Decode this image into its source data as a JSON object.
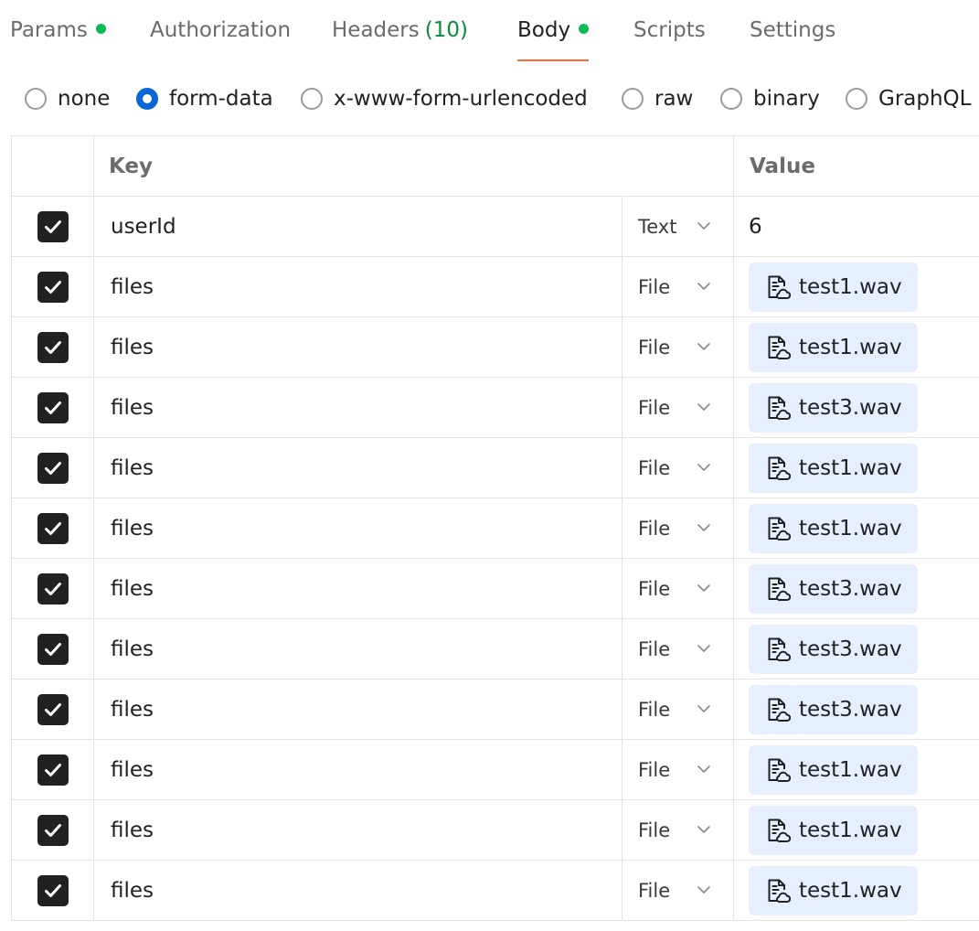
{
  "tabs": [
    {
      "label": "Params",
      "dot": true
    },
    {
      "label": "Authorization"
    },
    {
      "label": "Headers",
      "count": "(10)"
    },
    {
      "label": "Body",
      "dot": true,
      "active": true
    },
    {
      "label": "Scripts"
    },
    {
      "label": "Settings"
    }
  ],
  "body_types": [
    {
      "label": "none"
    },
    {
      "label": "form-data",
      "selected": true
    },
    {
      "label": "x-www-form-urlencoded"
    },
    {
      "label": "raw"
    },
    {
      "label": "binary"
    },
    {
      "label": "GraphQL"
    }
  ],
  "table": {
    "key_header": "Key",
    "value_header": "Value",
    "rows": [
      {
        "checked": true,
        "key": "userId",
        "type": "Text",
        "value": "6"
      },
      {
        "checked": true,
        "key": "files",
        "type": "File",
        "value": "test1.wav"
      },
      {
        "checked": true,
        "key": "files",
        "type": "File",
        "value": "test1.wav"
      },
      {
        "checked": true,
        "key": "files",
        "type": "File",
        "value": "test3.wav"
      },
      {
        "checked": true,
        "key": "files",
        "type": "File",
        "value": "test1.wav"
      },
      {
        "checked": true,
        "key": "files",
        "type": "File",
        "value": "test1.wav"
      },
      {
        "checked": true,
        "key": "files",
        "type": "File",
        "value": "test3.wav"
      },
      {
        "checked": true,
        "key": "files",
        "type": "File",
        "value": "test3.wav"
      },
      {
        "checked": true,
        "key": "files",
        "type": "File",
        "value": "test3.wav"
      },
      {
        "checked": true,
        "key": "files",
        "type": "File",
        "value": "test1.wav"
      },
      {
        "checked": true,
        "key": "files",
        "type": "File",
        "value": "test1.wav"
      },
      {
        "checked": true,
        "key": "files",
        "type": "File",
        "value": "test1.wav"
      }
    ]
  },
  "icons": {
    "file_value": "file-cloud-icon",
    "type_dropdown": "chevron-down-icon",
    "checkbox": "check-icon"
  },
  "colors": {
    "active_tab_underline": "#ff6c37",
    "status_dot": "#0cbb52",
    "header_count": "#0b8b3e",
    "radio_selected": "#0a66d6",
    "file_chip_bg": "#e6efff",
    "checkbox_fill": "#212121"
  }
}
